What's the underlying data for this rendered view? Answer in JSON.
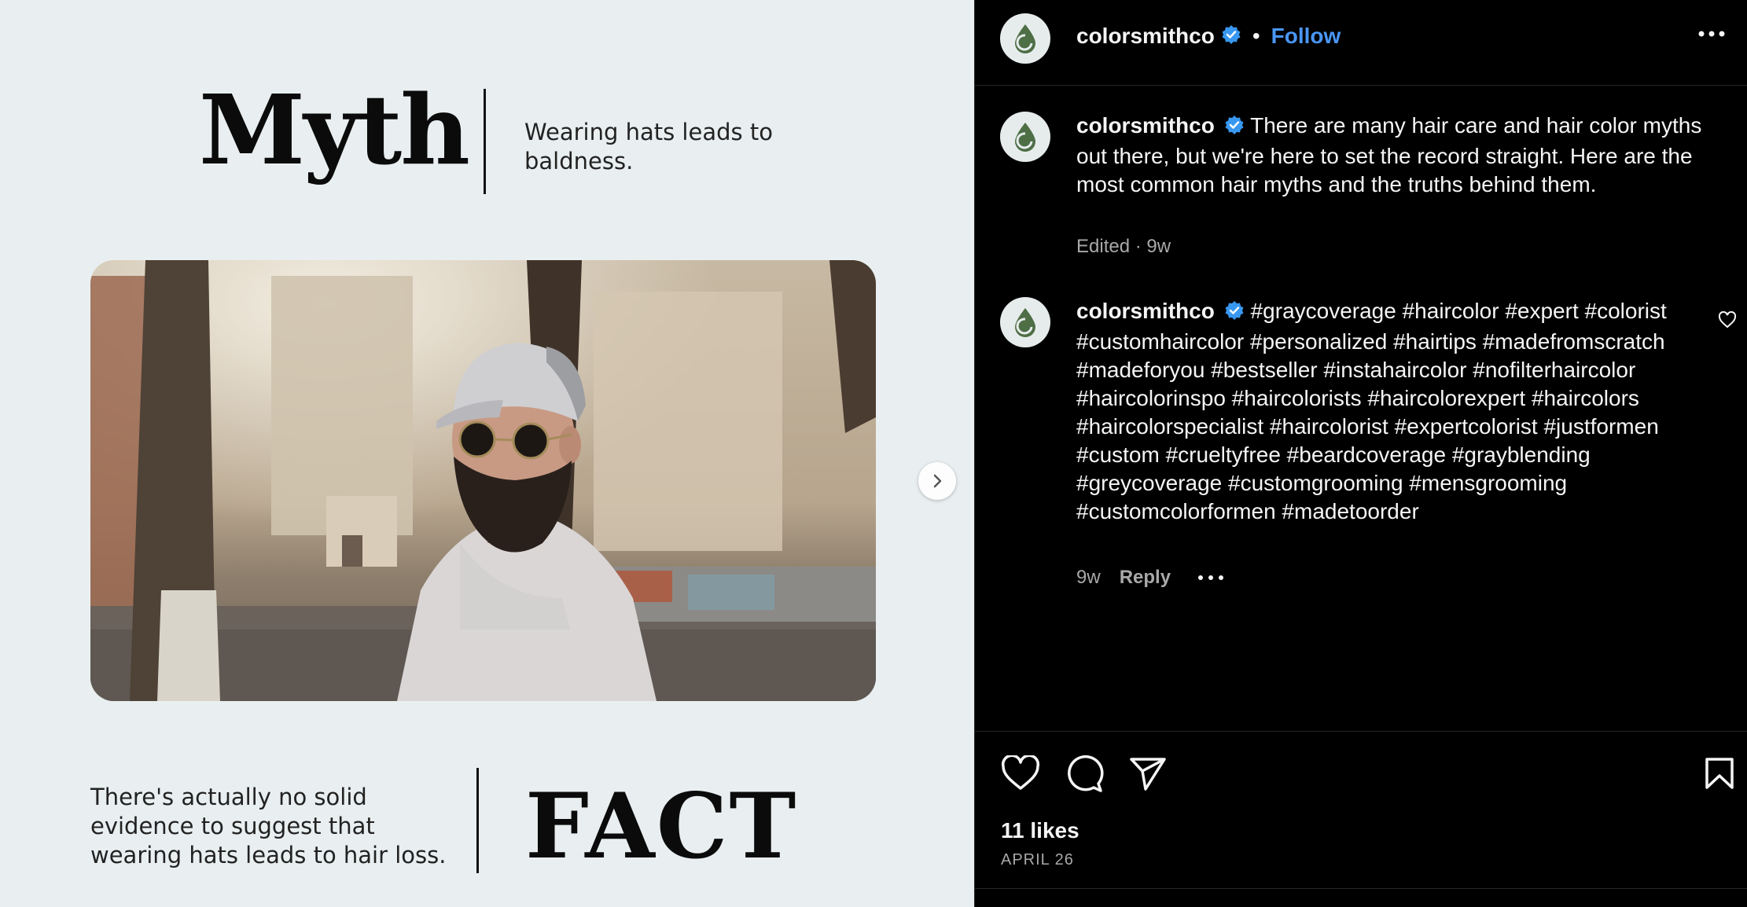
{
  "post_image": {
    "myth_title": "Myth",
    "myth_text": "Wearing hats leads to baldness.",
    "fact_text": "There's actually no solid evidence to suggest that wearing hats leads to hair loss.",
    "fact_title": "FACT",
    "next_icon": "chevron-right-icon"
  },
  "header": {
    "username": "colorsmithco",
    "separator": "•",
    "follow_label": "Follow",
    "more_icon": "more-horizontal-icon"
  },
  "caption": {
    "username": "colorsmithco",
    "text": "There are many hair care and hair color myths out there, but we're here to set the record straight. Here are the most common hair myths and the truths behind them.",
    "edited": "Edited · 9w"
  },
  "comment": {
    "username": "colorsmithco",
    "text": "#graycoverage #haircolor #expert #colorist #customhaircolor #personalized #hairtips #madefromscratch #madeforyou #bestseller #instahaircolor #nofilterhaircolor #haircolorinspo #haircolorists #haircolorexpert #haircolors #haircolorspecialist #haircolorist #expertcolorist #justformen #custom #crueltyfree #beardcoverage #grayblending #greycoverage #customgrooming #mensgrooming #customcolorformen #madetoorder",
    "time": "9w",
    "reply_label": "Reply"
  },
  "footer": {
    "likes": "11 likes",
    "date": "APRIL 26"
  },
  "colors": {
    "accent": "#4a96f5",
    "panel_bg": "#000000",
    "image_bg": "#e9eff0",
    "brand_green": "#4e6e45"
  }
}
